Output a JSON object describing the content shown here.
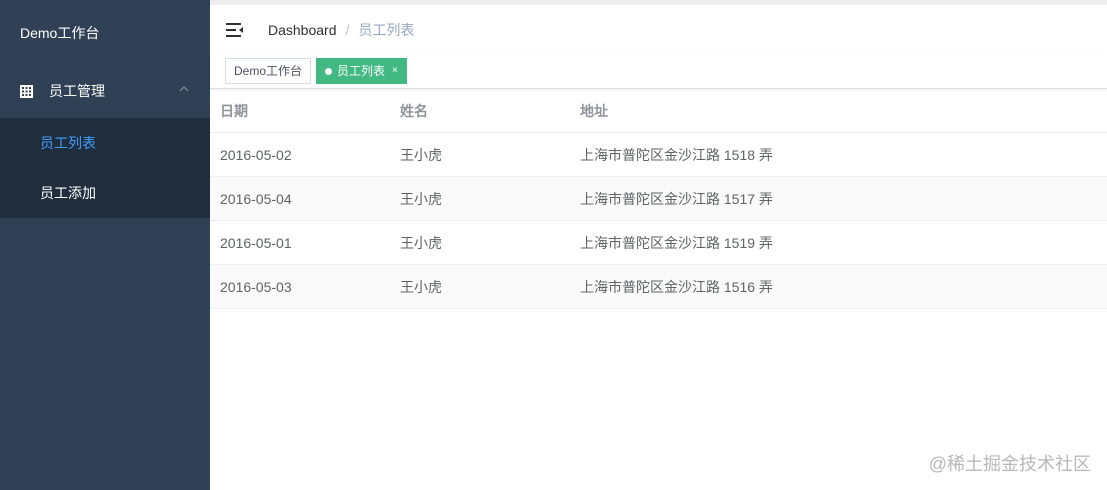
{
  "sidebar": {
    "brand": "Demo工作台",
    "group": {
      "label": "员工管理",
      "icon": "grid-icon",
      "chevron": "chevron-up-icon"
    },
    "items": [
      {
        "label": "员工列表",
        "active": true
      },
      {
        "label": "员工添加",
        "active": false
      }
    ]
  },
  "navbar": {
    "hamburger_icon": "hamburger-icon",
    "breadcrumb": {
      "root": "Dashboard",
      "separator": "/",
      "current": "员工列表"
    }
  },
  "tags": [
    {
      "label": "Demo工作台",
      "active": false
    },
    {
      "label": "员工列表",
      "active": true,
      "close": "×"
    }
  ],
  "table": {
    "headers": [
      "日期",
      "姓名",
      "地址"
    ],
    "rows": [
      [
        "2016-05-02",
        "王小虎",
        "上海市普陀区金沙江路 1518 弄"
      ],
      [
        "2016-05-04",
        "王小虎",
        "上海市普陀区金沙江路 1517 弄"
      ],
      [
        "2016-05-01",
        "王小虎",
        "上海市普陀区金沙江路 1519 弄"
      ],
      [
        "2016-05-03",
        "王小虎",
        "上海市普陀区金沙江路 1516 弄"
      ]
    ]
  },
  "watermark": "@稀土掘金技术社区",
  "colors": {
    "sidebar_bg": "#304156",
    "submenu_bg": "#1f2d3d",
    "active_link": "#409eff",
    "active_tag": "#42b983"
  }
}
